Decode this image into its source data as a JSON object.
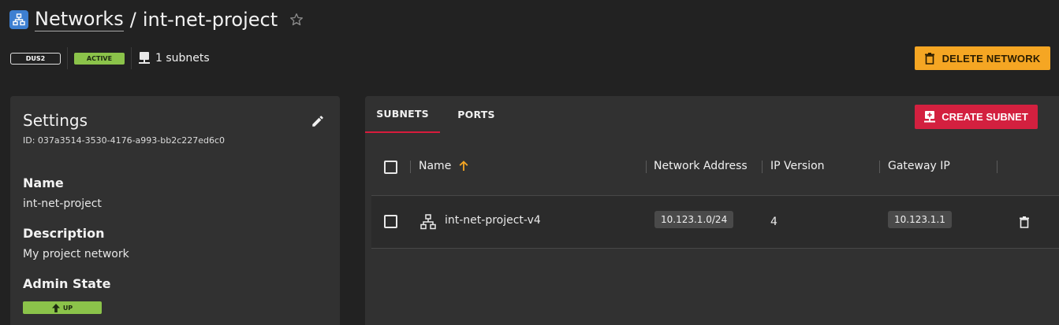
{
  "header": {
    "app_icon": "network-icon",
    "breadcrumb_link": "Networks",
    "separator": "/",
    "title": "int-net-project",
    "favorite_icon": "star-outline-icon"
  },
  "meta": {
    "region": "DUS2",
    "status": "ACTIVE",
    "subnets_icon": "subnet-icon",
    "subnets_count": "1 subnets",
    "status_color": "#8bc34a"
  },
  "actions": {
    "delete_network_label": "DELETE NETWORK",
    "delete_icon": "trash-icon",
    "delete_color": "#f5a623"
  },
  "settings": {
    "heading": "Settings",
    "id_text": "ID: 037a3514-3530-4176-a993-bb2c227ed6c0",
    "edit_icon": "pencil-icon",
    "name_label": "Name",
    "name_value": "int-net-project",
    "description_label": "Description",
    "description_value": "My project network",
    "admin_state_label": "Admin State",
    "admin_state_value": "UP",
    "admin_state_icon": "arrow-up-icon"
  },
  "tabs": [
    {
      "label": "SUBNETS",
      "active": true
    },
    {
      "label": "PORTS",
      "active": false
    }
  ],
  "create_subnet_label": "CREATE SUBNET",
  "create_subnet_icon": "add-subnet-icon",
  "accent_color": "#d3203f",
  "table": {
    "columns": [
      "Name",
      "Network Address",
      "IP Version",
      "Gateway IP"
    ],
    "sort": {
      "column": "Name",
      "direction": "ascending",
      "icon": "arrow-up-icon",
      "color": "#f5a623"
    },
    "rows": [
      {
        "icon": "network-topology-icon",
        "name": "int-net-project-v4",
        "network_address": "10.123.1.0/24",
        "ip_version": "4",
        "gateway_ip": "10.123.1.1",
        "action_icon": "trash-icon"
      }
    ]
  }
}
